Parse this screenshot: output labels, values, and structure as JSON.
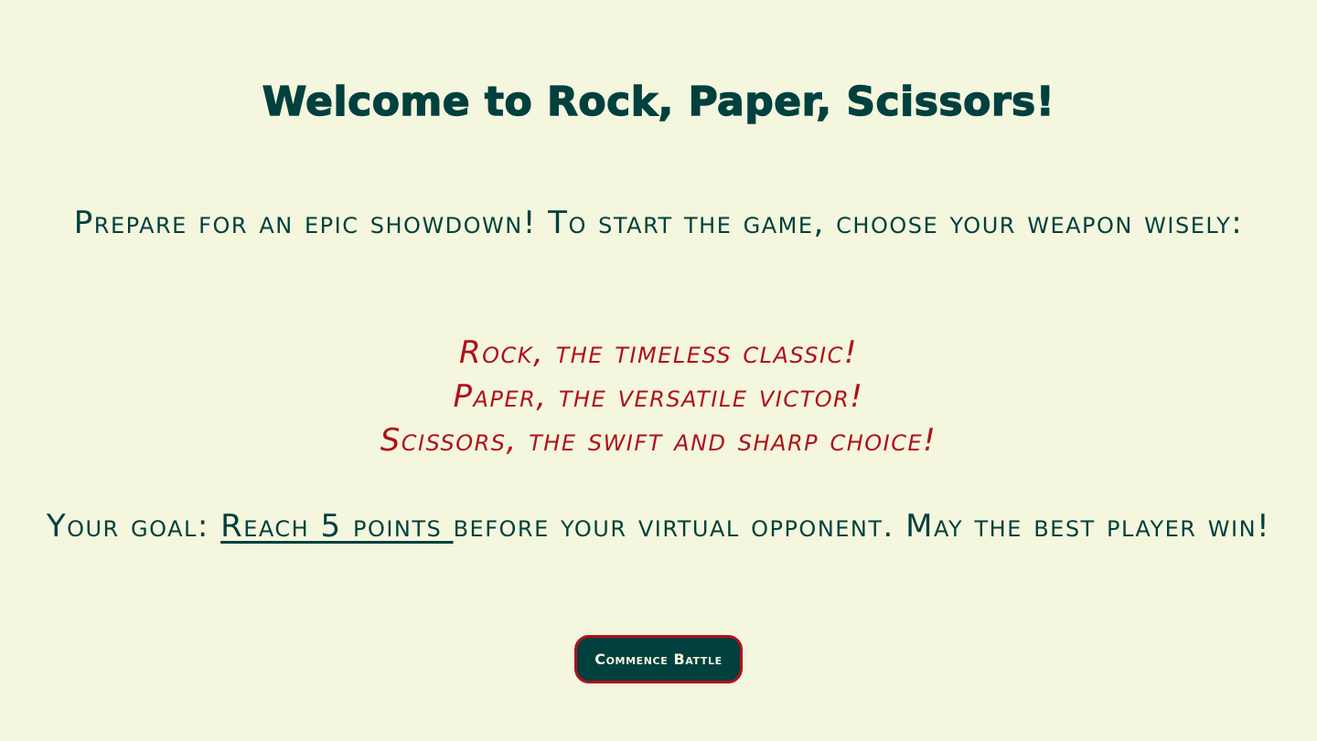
{
  "header": {
    "title": "Welcome to Rock, Paper, Scissors!"
  },
  "intro": {
    "text": "Prepare for an epic showdown! To start the game, choose your weapon wisely:"
  },
  "choices": [
    {
      "label": "Rock, the timeless classic!"
    },
    {
      "label": "Paper, the versatile victor!"
    },
    {
      "label": "Scissors, the swift and sharp choice!"
    }
  ],
  "goal": {
    "prefix": "Your goal: ",
    "target": "Reach 5 points ",
    "suffix": "before your virtual opponent. May the best player win!"
  },
  "actions": {
    "start_label": "Commence Battle"
  },
  "colors": {
    "background": "#f4f7dd",
    "primary": "#00403f",
    "accent": "#b0101c"
  }
}
